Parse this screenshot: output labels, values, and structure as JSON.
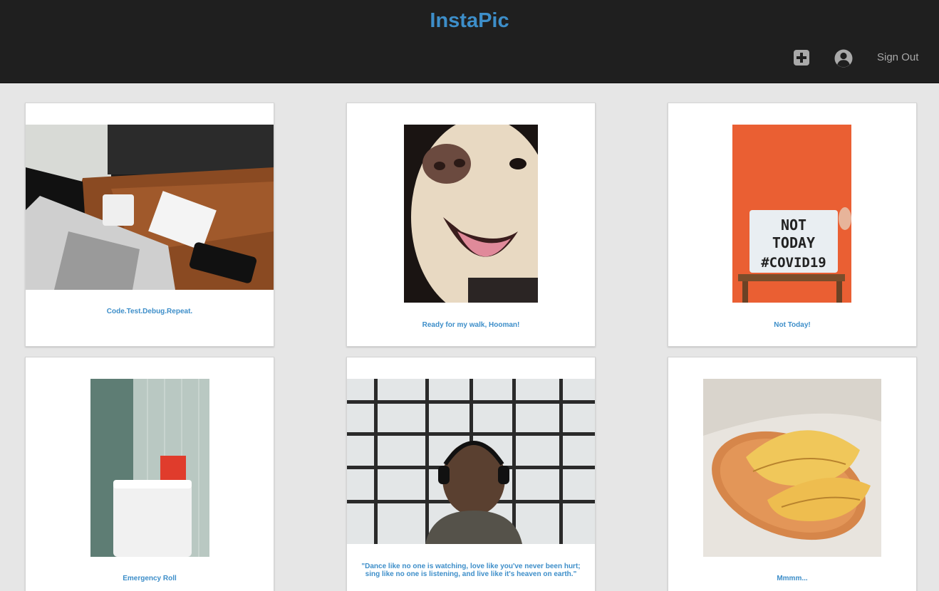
{
  "header": {
    "title": "InstaPic",
    "add_icon": "plus-square-icon",
    "account_icon": "user-circle-icon",
    "sign_out_label": "Sign Out"
  },
  "posts": [
    {
      "caption": "Code.Test.Debug.Repeat.",
      "photo": "laptop-desk-photo"
    },
    {
      "caption": "Ready for my walk, Hooman!",
      "photo": "dog-photo"
    },
    {
      "caption": "Not Today!",
      "photo": "lightbox-sign-photo"
    },
    {
      "caption": "Emergency Roll",
      "photo": "toilet-roll-photo"
    },
    {
      "caption": "\"Dance like no one is watching, love like you've never been hurt; sing like no one is listening, and live like it's heaven on earth.\"",
      "photo": "headphones-window-photo"
    },
    {
      "caption": "Mmmm...",
      "photo": "crepes-photo"
    }
  ],
  "photo_texts": {
    "lightbox_line1": "NOT",
    "lightbox_line2": "TODAY",
    "lightbox_line3": "#COVID19"
  },
  "colors": {
    "header_bg": "#1f1f1f",
    "brand": "#3d8ec9",
    "page_bg": "#e6e6e6",
    "card_bg": "#ffffff"
  }
}
